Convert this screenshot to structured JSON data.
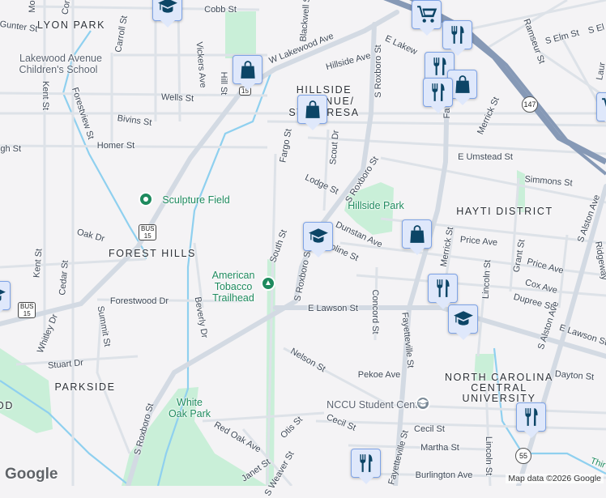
{
  "colors": {
    "background": "#f4f3f5",
    "road": "#d5dbe3",
    "highway": "#8699b6",
    "park": "#c9efd8",
    "water": "#8fd0ef",
    "marker_bg": "#dfe8fb",
    "marker_icon": "#0c4566",
    "poi_green": "#1e8a5e"
  },
  "areas": {
    "lyon_park": "LYON PARK",
    "hillside_1": "HILLSIDE",
    "hillside_2": "AVENUE/",
    "hillside_3": "ST. TERESA",
    "hayti": "HAYTI DISTRICT",
    "forest_hills": "FOREST HILLS",
    "parkside": "PARKSIDE",
    "nccu_1": "NORTH CAROLINA",
    "nccu_2": "CENTRAL",
    "nccu_3": "UNIVERSITY",
    "od": "OD"
  },
  "pois": {
    "school_1": "Lakewood Avenue",
    "school_2": "Children's School",
    "sculpture": "Sculpture Field",
    "trail_1": "American",
    "trail_2": "Tobacco",
    "trail_3": "Trailhead",
    "hillside_park": "Hillside Park",
    "white_oak_1": "White",
    "white_oak_2": "Oak Park",
    "nccu_center": "NCCU Student Center"
  },
  "streets": {
    "cobb": "Cobb St",
    "gunter": "Gunter St",
    "mo": "Mo",
    "con": "Con",
    "carroll": "Carroll St",
    "vickers": "Vickers Ave",
    "hill": "Hill St",
    "w_lakewood": "W Lakewood Ave",
    "kent": "Kent St",
    "forestview": "Forestview St",
    "wells": "Wells St",
    "bivins": "Bivins St",
    "homer": "Homer St",
    "igh": "igh St",
    "blackwell": "Blackwell St",
    "fargo": "Fargo St",
    "scout": "Scout Dr",
    "e_lakewood": "E Lakew",
    "hillside_ave": "Hillside Ave",
    "roxboro_1": "S Roxboro St",
    "roxboro_2": "S Roxboro St",
    "roxboro_3": "S Roxboro St",
    "roxboro_4": "S Roxboro St",
    "fayetteville_1": "Fa",
    "fayetteville_2": "Fayetteville St",
    "fayetteville_3": "Fayetteville St",
    "merrick_1": "Merrick St",
    "merrick_2": "Merrick St",
    "ramseur": "Ramseur St",
    "s_elm": "S Elm St",
    "s_el": "S El",
    "laur": "Laur",
    "umstead": "E Umstead St",
    "simmons": "Simmons St",
    "lodge": "Lodge St",
    "dunstan": "Dunstan Ave",
    "caroline": "oline St",
    "price_1": "Price Ave",
    "price_2": "Price Ave",
    "grant": "Grant St",
    "ridgeway": "Ridgeway",
    "lincoln_1": "Lincoln St",
    "lincoln_2": "Lincoln St",
    "cox": "Cox Ave",
    "dupree": "Dupree St",
    "alston_1": "S Alston Ave",
    "alston_2": "S Alston Ave",
    "lawson_1": "E Lawson St",
    "lawson_2": "E Lawson St",
    "concord": "Concord St",
    "nelson": "Nelson St",
    "pekoe": "Pekoe Ave",
    "dayton": "Dayton St",
    "cecil_1": "Cecil St",
    "cecil_2": "Cecil St",
    "martha": "Martha St",
    "burlington": "Burlington Ave",
    "third": "Thir",
    "south": "South St",
    "kent_2": "Kent St",
    "cedar": "Cedar St",
    "forestwood": "Forestwood Dr",
    "beverly": "Beverly Dr",
    "summit": "Summit St",
    "whitley": "Whitley Dr",
    "stuart": "Stuart Dr",
    "oak": "Oak Dr",
    "red_oak": "Red Oak Ave",
    "otis": "Otis St",
    "janet": "Janet St",
    "weaver": "S Weaver St"
  },
  "shields": {
    "bus15_a_top": "BUS",
    "bus15_a_num": "15",
    "bus15_b_top": "BUS",
    "bus15_b_num": "15",
    "us15": "15",
    "nc147": "147",
    "nc55": "55"
  },
  "markers": [
    {
      "type": "school"
    },
    {
      "type": "shopping"
    },
    {
      "type": "shopping"
    },
    {
      "type": "grocery"
    },
    {
      "type": "restaurant"
    },
    {
      "type": "restaurant"
    },
    {
      "type": "shopping"
    },
    {
      "type": "restaurant"
    },
    {
      "type": "grocery"
    },
    {
      "type": "school"
    },
    {
      "type": "shopping"
    },
    {
      "type": "school"
    },
    {
      "type": "restaurant"
    },
    {
      "type": "school"
    },
    {
      "type": "restaurant"
    },
    {
      "type": "restaurant"
    }
  ],
  "footer": {
    "logo": "Google",
    "credit": "Map data ©2026 Google"
  }
}
